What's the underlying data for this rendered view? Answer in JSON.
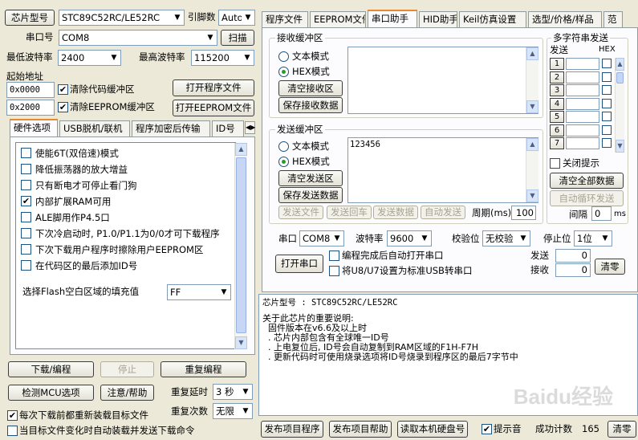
{
  "left": {
    "chip_type_button": "芯片型号",
    "chip_type_value": "STC89C52RC/LE52RC",
    "pin_count_label": "引脚数",
    "pin_count_value": "Auto",
    "com_button": "串口号",
    "com_value": "COM8",
    "scan_button": "扫描",
    "min_baud_label": "最低波特率",
    "min_baud_value": "2400",
    "max_baud_label": "最高波特率",
    "max_baud_value": "115200",
    "start_addr_label": "起始地址",
    "addr1_value": "0x0000",
    "clear_code_label": "清除代码缓冲区",
    "open_program_button": "打开程序文件",
    "addr2_value": "0x2000",
    "clear_eeprom_label": "清除EEPROM缓冲区",
    "open_eeprom_button": "打开EEPROM文件",
    "tabs": [
      "硬件选项",
      "USB脱机/联机",
      "程序加密后传输",
      "ID号"
    ],
    "options": [
      {
        "label": "使能6T(双倍速)模式",
        "checked": false
      },
      {
        "label": "降低振荡器的放大增益",
        "checked": false
      },
      {
        "label": "只有断电才可停止看门狗",
        "checked": false
      },
      {
        "label": "内部扩展RAM可用",
        "checked": true
      },
      {
        "label": "ALE脚用作P4.5口",
        "checked": false
      },
      {
        "label": "下次冷启动时, P1.0/P1.1为0/0才可下载程序",
        "checked": false
      },
      {
        "label": "下次下载用户程序时擦除用户EEPROM区",
        "checked": false
      },
      {
        "label": "在代码区的最后添加ID号",
        "checked": false
      }
    ],
    "flash_fill_label": "选择Flash空白区域的填充值",
    "flash_fill_value": "FF",
    "download_button": "下载/编程",
    "stop_button": "停止",
    "reprogram_button": "重复编程",
    "detect_button": "检测MCU选项",
    "help_button": "注意/帮助",
    "repeat_delay_label": "重复延时",
    "repeat_delay_value": "3 秒",
    "repeat_count_label": "重复次数",
    "repeat_count_value": "无限",
    "reload_label": "每次下载前都重新装载目标文件",
    "reload_checked": true,
    "auto_load_label": "当目标文件变化时自动装载并发送下载命令",
    "auto_load_checked": false
  },
  "right": {
    "tabs": [
      "程序文件",
      "EEPROM文件",
      "串口助手",
      "HID助手",
      "Keil仿真设置",
      "选型/价格/样品",
      "范"
    ],
    "active_tab": 2,
    "recv_group": "接收缓冲区",
    "recv_text_mode": "文本模式",
    "recv_hex_mode": "HEX模式",
    "recv_clear_button": "清空接收区",
    "recv_save_button": "保存接收数据",
    "recv_content": "",
    "send_group": "发送缓冲区",
    "send_text_mode": "文本模式",
    "send_hex_mode": "HEX模式",
    "send_clear_button": "清空发送区",
    "send_save_button": "保存发送数据",
    "send_content": "123456",
    "send_file_button": "发送文件",
    "send_enter_button": "发送回车",
    "send_data_button": "发送数据",
    "auto_send_button": "自动发送",
    "period_label": "周期(ms)",
    "period_value": "100",
    "multi_group": "多字符串发送",
    "multi_send_header": "发送",
    "multi_hex_header": "HEX",
    "multi_rows": [
      "1",
      "2",
      "3",
      "4",
      "5",
      "6",
      "7"
    ],
    "close_hint_label": "关闭提示",
    "clear_all_button": "清空全部数据",
    "auto_loop_button": "自动循环发送",
    "interval_label": "间隔",
    "interval_value": "0",
    "interval_unit": "ms",
    "port_label": "串口",
    "port_value": "COM8",
    "baud_label": "波特率",
    "baud_value": "9600",
    "parity_label": "校验位",
    "parity_value": "无校验",
    "stopbit_label": "停止位",
    "stopbit_value": "1位",
    "open_port_button": "打开串口",
    "auto_open_label": "编程完成后自动打开串口",
    "usb_label": "将U8/U7设置为标准USB转串口",
    "send_count_label": "发送",
    "send_count_value": "0",
    "recv_count_label": "接收",
    "recv_count_value": "0",
    "clear_count_button": "清零"
  },
  "info": {
    "chip_line": "芯片型号 : STC89C52RC/LE52RC",
    "lines": [
      "关于此芯片的重要说明:",
      "  固件版本在v6.6及以上时",
      "  . 芯片内部包含有全球唯一ID号",
      "  . 上电复位后, ID号会自动复制到RAM区域的F1H-F7H",
      "  . 更新代码时可使用烧录选项将ID号烧录到程序区的最后7字节中"
    ]
  },
  "bottom": {
    "publish_button": "发布项目程序",
    "publish_help_button": "发布项目帮助",
    "read_disk_button": "读取本机硬盘号",
    "sound_label": "提示音",
    "sound_checked": true,
    "success_label": "成功计数",
    "success_value": "165",
    "clear_button": "清零"
  },
  "watermark": "Baidu经验"
}
